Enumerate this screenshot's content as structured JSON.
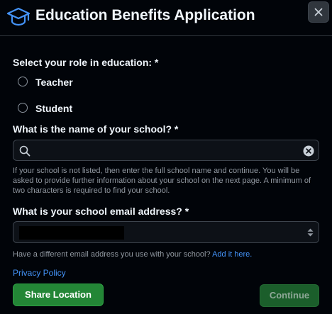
{
  "dialog": {
    "title": "Education Benefits Application",
    "header_icon": "mortarboard-icon",
    "close_icon": "close-icon"
  },
  "role": {
    "label": "Select your role in education: *",
    "options": [
      {
        "label": "Teacher",
        "selected": false
      },
      {
        "label": "Student",
        "selected": false
      }
    ]
  },
  "school": {
    "label": "What is the name of your school? *",
    "value": "",
    "placeholder": "",
    "search_icon": "search-icon",
    "clear_icon": "clear-icon",
    "help": "If your school is not listed, then enter the full school name and continue. You will be asked to provide further information about your school on the next page. A minimum of two characters is required to find your school."
  },
  "email": {
    "label": "What is your school email address? *",
    "value": "",
    "select_icon": "updown-arrows-icon",
    "alt_text": "Have a different email address you use with your school?",
    "alt_link": "Add it here."
  },
  "privacy_link": "Privacy Policy",
  "buttons": {
    "share_location": "Share Location",
    "continue": "Continue"
  },
  "colors": {
    "background": "#010409",
    "primary_button": "#238636",
    "link": "#4493f8",
    "accent_icon": "#4493f8"
  }
}
